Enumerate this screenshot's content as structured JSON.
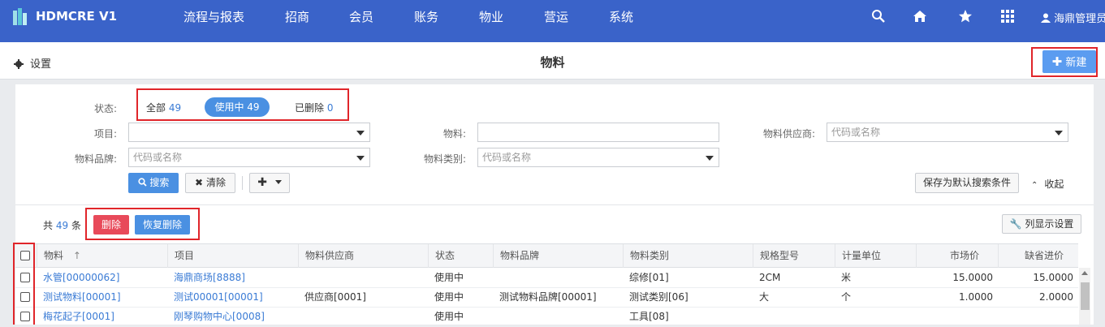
{
  "app": {
    "brand": "HDMCRE V1",
    "user": "海鼎管理员"
  },
  "nav": [
    {
      "label": "流程与报表"
    },
    {
      "label": "招商"
    },
    {
      "label": "会员"
    },
    {
      "label": "账务"
    },
    {
      "label": "物业"
    },
    {
      "label": "营运"
    },
    {
      "label": "系统"
    }
  ],
  "toolbar_icons": [
    "search-icon",
    "home-icon",
    "star-icon",
    "grid-icon",
    "user-icon"
  ],
  "subbar": {
    "settings": "设置",
    "title": "物料",
    "new_button": "新建"
  },
  "filter": {
    "status_label": "状态:",
    "tab_all": "全部",
    "tab_all_count": "49",
    "tab_use": "使用中",
    "tab_use_count": "49",
    "tab_del": "已删除",
    "tab_del_count": "0",
    "project_label": "项目:",
    "material_label": "物料:",
    "supplier_label": "物料供应商:",
    "supplier_placeholder": "代码或名称",
    "brand_label": "物料品牌:",
    "brand_placeholder": "代码或名称",
    "category_label": "物料类别:",
    "category_placeholder": "代码或名称",
    "search_button": "搜索",
    "clear_button": "清除",
    "save_default": "保存为默认搜索条件",
    "collapse": "收起"
  },
  "list": {
    "total_prefix": "共",
    "total_count": "49",
    "total_suffix": "条",
    "delete_button": "删除",
    "restore_button": "恢复删除",
    "column_settings": "列显示设置"
  },
  "table": {
    "headers": [
      "物料",
      "项目",
      "物料供应商",
      "状态",
      "物料品牌",
      "物料类别",
      "规格型号",
      "计量单位",
      "市场价",
      "缺省进价"
    ],
    "rows": [
      {
        "material": "水管[00000062]",
        "project": "海鼎商场[8888]",
        "supplier": "",
        "status": "使用中",
        "brand": "",
        "category": "综修[01]",
        "spec": "2CM",
        "unit": "米",
        "market_price": "15.0000",
        "default_price": "15.0000"
      },
      {
        "material": "测试物料[00001]",
        "project": "测试00001[00001]",
        "supplier": "供应商[0001]",
        "status": "使用中",
        "brand": "测试物料品牌[00001]",
        "category": "测试类别[06]",
        "spec": "大",
        "unit": "个",
        "market_price": "1.0000",
        "default_price": "2.0000"
      },
      {
        "material": "梅花起子[0001]",
        "project": "刚琴购物中心[0008]",
        "supplier": "",
        "status": "使用中",
        "brand": "",
        "category": "工具[08]",
        "spec": "",
        "unit": "",
        "market_price": "",
        "default_price": ""
      }
    ]
  },
  "colors": {
    "topbar": "#3a63c9",
    "accent": "#4a90e2",
    "danger": "#e84a5a",
    "highlight": "#e0252a"
  }
}
